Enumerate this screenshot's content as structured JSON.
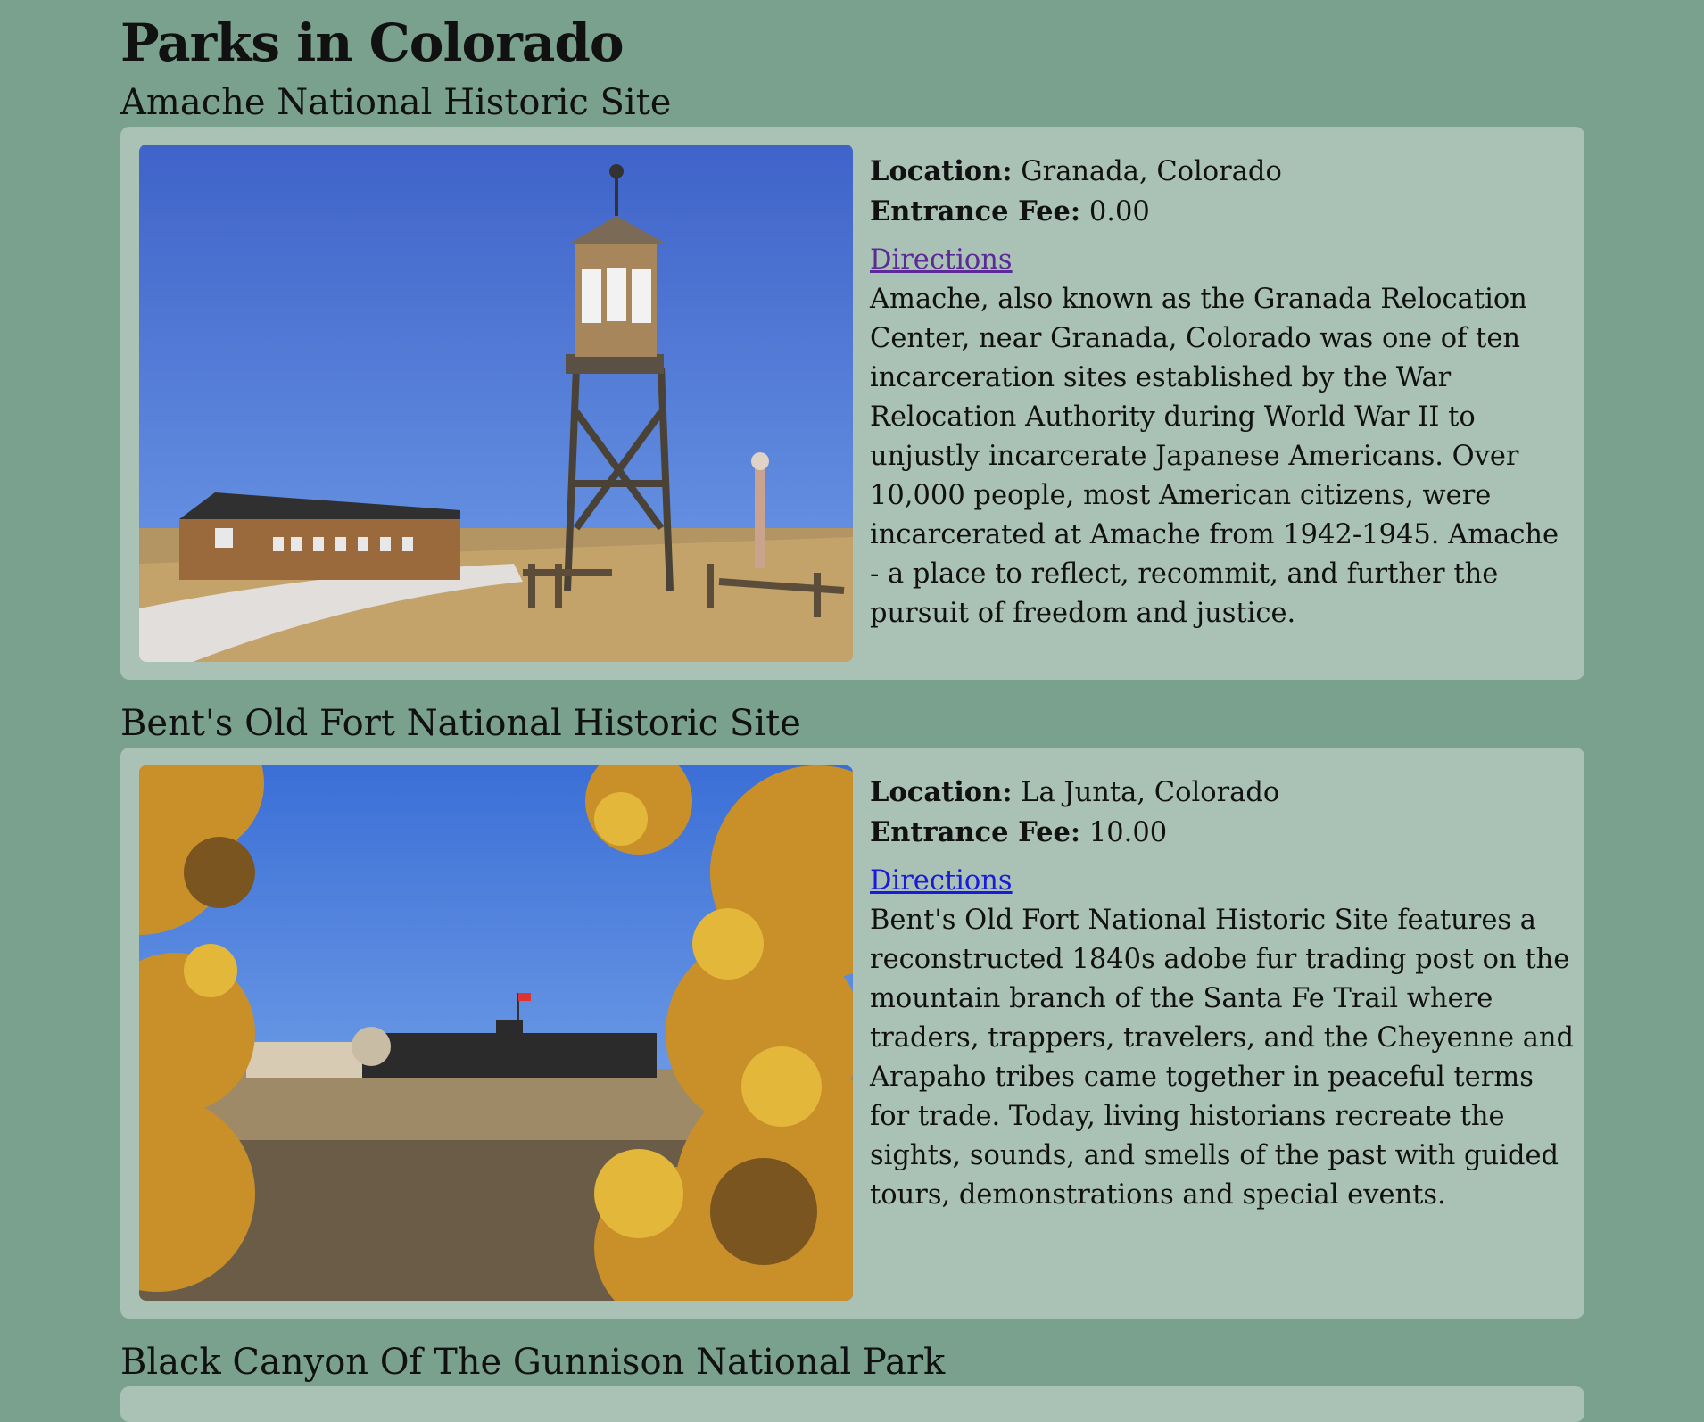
{
  "page": {
    "title": "Parks in Colorado"
  },
  "labels": {
    "location": "Location:",
    "fee": "Entrance Fee:"
  },
  "parks": [
    {
      "name": "Amache National Historic Site",
      "location": "Granada, Colorado",
      "fee": "0.00",
      "directions": "Directions",
      "description": "Amache, also known as the Granada Relocation Center, near Granada, Colorado was one of ten incarceration sites established by the War Relocation Authority during World War II to unjustly incarcerate Japanese Americans. Over 10,000 people, most American citizens, were incarcerated at Amache from 1942-1945. Amache - a place to reflect, recommit, and further the pursuit of freedom and justice."
    },
    {
      "name": "Bent's Old Fort National Historic Site",
      "location": "La Junta, Colorado",
      "fee": "10.00",
      "directions": "Directions",
      "description": "Bent's Old Fort National Historic Site features a reconstructed 1840s adobe fur trading post on the mountain branch of the Santa Fe Trail where traders, trappers, travelers, and the Cheyenne and Arapaho tribes came together in peaceful terms for trade. Today, living historians recreate the sights, sounds, and smells of the past with guided tours, demonstrations and special events."
    },
    {
      "name": "Black Canyon Of The Gunnison National Park"
    }
  ],
  "colors": {
    "background": "#7aa18e",
    "card": "#aac1b6",
    "link_visited": "#5b2a96",
    "link": "#1a1adb"
  }
}
